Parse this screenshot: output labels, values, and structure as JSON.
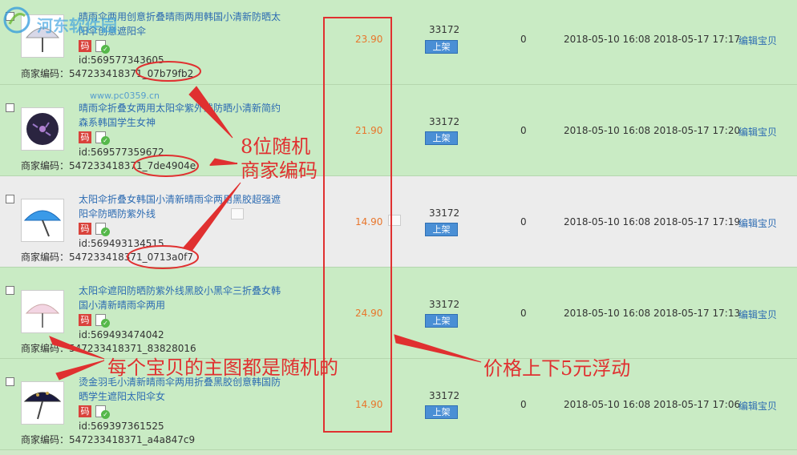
{
  "watermark": {
    "site_name": "河东软件园",
    "url": "www.pc0359.cn"
  },
  "rows": [
    {
      "title": "晴雨伞两用创意折叠晴雨两用韩国小清新防晒太阳伞创意遮阳伞",
      "ma": "码",
      "id": "id:569577343605",
      "code": "商家编码：547233418371_07b79fb2",
      "price": "23.90",
      "stock": "33172",
      "btn": "上架",
      "sales": "0",
      "dates": "2018-05-10 16:08 2018-05-17 17:17",
      "edit": "编辑宝贝"
    },
    {
      "title": "晴雨伞折叠女两用太阳伞紫外线防晒小清新简约森系韩国学生女神",
      "ma": "码",
      "id": "id:569577359672",
      "code": "商家编码：547233418371_7de4904e",
      "price": "21.90",
      "stock": "33172",
      "btn": "上架",
      "sales": "0",
      "dates": "2018-05-10 16:08 2018-05-17 17:20",
      "edit": "编辑宝贝"
    },
    {
      "title": "太阳伞折叠女韩国小清新晴雨伞两用黑胶超强遮阳伞防晒防紫外线",
      "ma": "码",
      "id": "id:569493134515",
      "code": "商家编码：547233418371_0713a0f7",
      "price": "14.90",
      "stock": "33172",
      "btn": "上架",
      "sales": "0",
      "dates": "2018-05-10 16:08 2018-05-17 17:19",
      "edit": "编辑宝贝"
    },
    {
      "title": "太阳伞遮阳防晒防紫外线黑胶小黑伞三折叠女韩国小清新晴雨伞两用",
      "ma": "码",
      "id": "id:569493474042",
      "code": "商家编码：547233418371_83828016",
      "price": "24.90",
      "stock": "33172",
      "btn": "上架",
      "sales": "0",
      "dates": "2018-05-10 16:08 2018-05-17 17:13",
      "edit": "编辑宝贝"
    },
    {
      "title": "烫金羽毛小清新晴雨伞两用折叠黑胶创意韩国防晒学生遮阳太阳伞女",
      "ma": "码",
      "id": "id:569397361525",
      "code": "商家编码：547233418371_a4a847c9",
      "price": "14.90",
      "stock": "33172",
      "btn": "上架",
      "sales": "0",
      "dates": "2018-05-10 16:08 2018-05-17 17:06",
      "edit": "编辑宝贝"
    }
  ],
  "annotations": {
    "random_code": "8位随机\n商家编码",
    "random_image": "每个宝贝的主图都是随机的",
    "price_float": "价格上下5元浮动"
  },
  "colors": {
    "annotation_red": "#e03030",
    "link_blue": "#2c6bb2",
    "price_orange": "#e8762c",
    "row_green": "#c9ebc4",
    "row_gray": "#ececec"
  }
}
